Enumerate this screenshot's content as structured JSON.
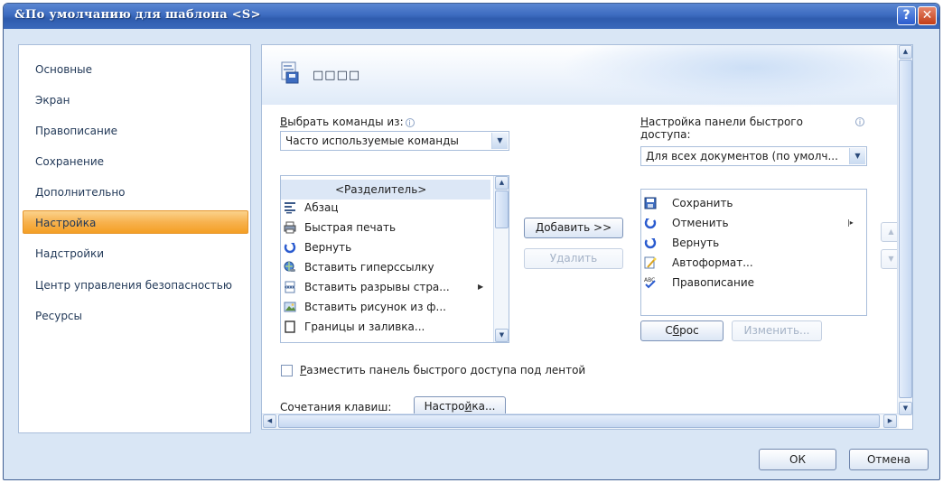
{
  "window": {
    "title": "&По умолчанию для шаблона <S>",
    "help_label": "?",
    "close_label": "✕"
  },
  "nav": {
    "items": [
      {
        "label": "Основные",
        "active": false
      },
      {
        "label": "Экран",
        "active": false
      },
      {
        "label": "Правописание",
        "active": false
      },
      {
        "label": "Сохранение",
        "active": false
      },
      {
        "label": "Дополнительно",
        "active": false
      },
      {
        "label": "Настройка",
        "active": true
      },
      {
        "label": "Надстройки",
        "active": false
      },
      {
        "label": "Центр управления безопасностью",
        "active": false
      },
      {
        "label": "Ресурсы",
        "active": false
      }
    ]
  },
  "page": {
    "title": "□□□□"
  },
  "choose_commands": {
    "label_prefix": "В",
    "label_rest": "ыбрать команды из:",
    "selected": "Часто используемые команды"
  },
  "qat_settings": {
    "label_line1_prefix": "Н",
    "label_line1_rest": "астройка панели быстрого",
    "label_line2": "доступа:",
    "selected": "Для всех документов (по умолч..."
  },
  "commands_list": [
    {
      "label": "<Разделитель>",
      "icon": "separator",
      "submenu": false
    },
    {
      "label": "Абзац",
      "icon": "paragraph-icon",
      "submenu": false
    },
    {
      "label": "Быстрая печать",
      "icon": "printer-icon",
      "submenu": false
    },
    {
      "label": "Вернуть",
      "icon": "redo-icon",
      "submenu": false
    },
    {
      "label": "Вставить гиперссылку",
      "icon": "hyperlink-icon",
      "submenu": false
    },
    {
      "label": "Вставить разрывы стра...",
      "icon": "page-break-icon",
      "submenu": true
    },
    {
      "label": "Вставить рисунок из ф...",
      "icon": "picture-icon",
      "submenu": false
    },
    {
      "label": "Границы и заливка...",
      "icon": "borders-icon",
      "submenu": false
    }
  ],
  "qat_list": [
    {
      "label": "Сохранить",
      "icon": "save-icon"
    },
    {
      "label": "Отменить",
      "icon": "undo-icon"
    },
    {
      "label": "Вернуть",
      "icon": "redo-icon"
    },
    {
      "label": "Автоформат...",
      "icon": "autoformat-icon"
    },
    {
      "label": "Правописание",
      "icon": "spelling-icon"
    }
  ],
  "buttons": {
    "add_prefix": "Д",
    "add_rest": "обавить >>",
    "remove": "Удалить",
    "reset_prefix": "С",
    "reset_u": "б",
    "reset_rest": "рос",
    "modify": "Изменить...",
    "move_up": "▲",
    "move_down": "▼",
    "keyboard_prefix": "Настро",
    "keyboard_u": "й",
    "keyboard_rest": "ка...",
    "ok": "ОК",
    "cancel": "Отмена"
  },
  "checkbox": {
    "label_u": "Р",
    "label_rest": "азместить панель быстрого доступа под лентой",
    "checked": false
  },
  "shortcuts": {
    "label": "Сочетания клавиш:"
  }
}
